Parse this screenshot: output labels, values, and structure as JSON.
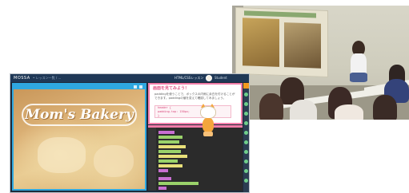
{
  "app": {
    "logo": "MOSSA",
    "breadcrumb": "• レッスン一覧 / ...",
    "center_title": "HTML/CSSレッスン",
    "username": "Student"
  },
  "preview": {
    "title": "Mom's Bakery"
  },
  "lesson": {
    "title": "画面を見てみよう！",
    "body": "paddingを使うことで、ボックスの内側に余白を付けることができます。paddingの値を変えて確認してみましょう。",
    "code_lines": [
      "header {",
      "  padding-top: 150px;",
      "}"
    ]
  },
  "colors": {
    "accent_blue": "#2fa8e0",
    "accent_pink": "#f07ca8",
    "navbar": "#1f3856"
  },
  "icons": [
    "avatar-icon",
    "cat-mascot",
    "rail-button-icon"
  ]
}
